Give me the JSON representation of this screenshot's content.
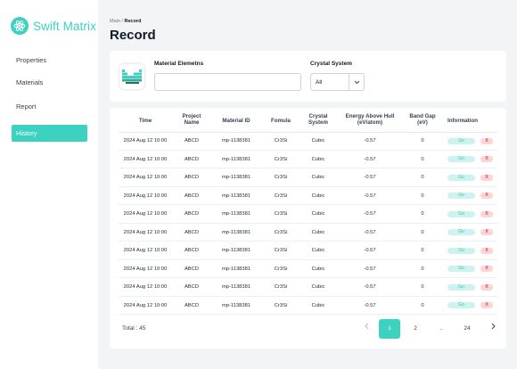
{
  "app": {
    "name": "Swift Matrix",
    "accent": "#3dd1bf"
  },
  "sidebar": {
    "items": [
      {
        "label": "Properties",
        "active": false
      },
      {
        "label": "Materials",
        "active": false
      },
      {
        "label": "Report",
        "active": false
      },
      {
        "label": "History",
        "active": true
      }
    ]
  },
  "breadcrumb": {
    "parent": "Main",
    "separator": " / ",
    "current": "Record"
  },
  "page_title": "Record",
  "filters": {
    "material_elements_label": "Material Elemetns",
    "material_elements_value": "",
    "crystal_system_label": "Crystal System",
    "crystal_system_value": "All"
  },
  "table": {
    "columns": [
      {
        "line1": "Time",
        "line2": ""
      },
      {
        "line1": "Project",
        "line2": "Name"
      },
      {
        "line1": "Material ID",
        "line2": ""
      },
      {
        "line1": "Fomula",
        "line2": ""
      },
      {
        "line1": "Crystal",
        "line2": "System"
      },
      {
        "line1": "Energy Above Hull",
        "line2": "(eV/atom)"
      },
      {
        "line1": "Band Gap",
        "line2": "(eV)"
      },
      {
        "line1": "Information",
        "line2": ""
      }
    ],
    "go_label": "Go",
    "delete_label": "X",
    "rows": [
      {
        "time": "2024 Aug 12 10:00",
        "project": "ABCD",
        "material_id": "mp-1138381",
        "formula": "Cr3Si",
        "crystal": "Cubic",
        "energy": "-0.57",
        "band_gap": "0"
      },
      {
        "time": "2024 Aug 12 10:00",
        "project": "ABCD",
        "material_id": "mp-1138381",
        "formula": "Cr3Si",
        "crystal": "Cubic",
        "energy": "-0.57",
        "band_gap": "0"
      },
      {
        "time": "2024 Aug 12 10:00",
        "project": "ABCD",
        "material_id": "mp-1138381",
        "formula": "Cr3Si",
        "crystal": "Cubic",
        "energy": "-0.57",
        "band_gap": "0"
      },
      {
        "time": "2024 Aug 12 10:00",
        "project": "ABCD",
        "material_id": "mp-1138381",
        "formula": "Cr3Si",
        "crystal": "Cubic",
        "energy": "-0.57",
        "band_gap": "0"
      },
      {
        "time": "2024 Aug 12 10:00",
        "project": "ABCD",
        "material_id": "mp-1138381",
        "formula": "Cr3Si",
        "crystal": "Cubic",
        "energy": "-0.57",
        "band_gap": "0"
      },
      {
        "time": "2024 Aug 12 10:00",
        "project": "ABCD",
        "material_id": "mp-1138381",
        "formula": "Cr3Si",
        "crystal": "Cubic",
        "energy": "-0.57",
        "band_gap": "0"
      },
      {
        "time": "2024 Aug 12 10:00",
        "project": "ABCD",
        "material_id": "mp-1138381",
        "formula": "Cr3Si",
        "crystal": "Cubic",
        "energy": "-0.57",
        "band_gap": "0"
      },
      {
        "time": "2024 Aug 12 10:00",
        "project": "ABCD",
        "material_id": "mp-1138381",
        "formula": "Cr3Si",
        "crystal": "Cubic",
        "energy": "-0.57",
        "band_gap": "0"
      },
      {
        "time": "2024 Aug 12 10:00",
        "project": "ABCD",
        "material_id": "mp-1138381",
        "formula": "Cr3Si",
        "crystal": "Cubic",
        "energy": "-0.57",
        "band_gap": "0"
      },
      {
        "time": "2024 Aug 12 10:00",
        "project": "ABCD",
        "material_id": "mp-1138381",
        "formula": "Cr3Si",
        "crystal": "Cubic",
        "energy": "-0.57",
        "band_gap": "0"
      }
    ]
  },
  "pagination": {
    "total_label": "Total : 45",
    "prev_icon": "chevron-left-icon",
    "pages": [
      "1",
      "2",
      "..",
      "24"
    ],
    "current_page": "1",
    "next_icon": "chevron-right-icon"
  }
}
